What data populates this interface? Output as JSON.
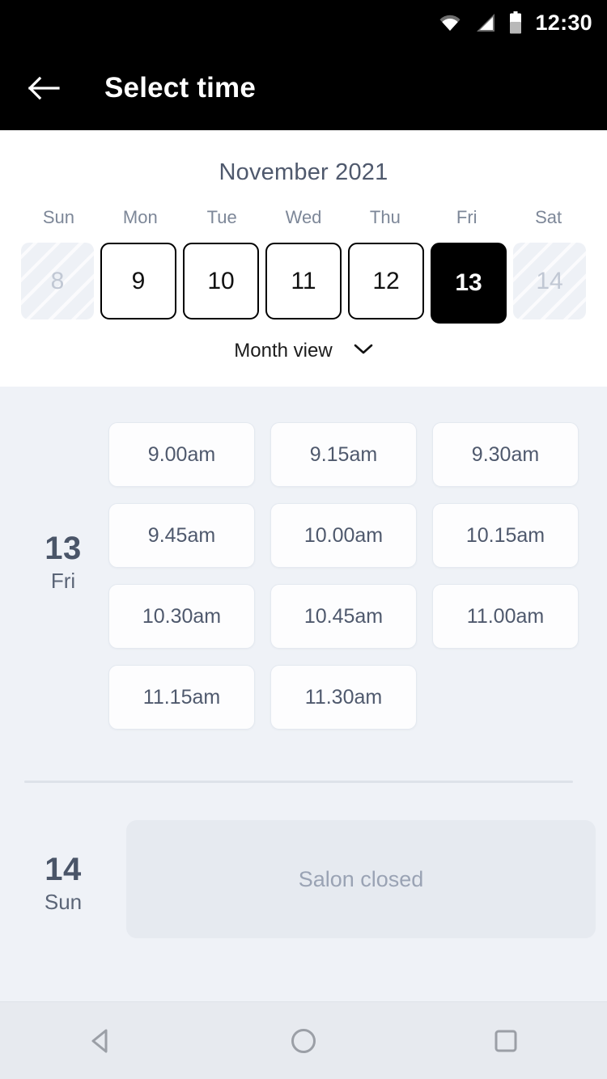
{
  "statusbar": {
    "time": "12:30",
    "icons": [
      "wifi-icon",
      "signal-icon",
      "battery-icon"
    ]
  },
  "appbar": {
    "title": "Select time",
    "back_icon": "arrow-left-icon"
  },
  "calendar": {
    "month_title": "November 2021",
    "weekdays": [
      "Sun",
      "Mon",
      "Tue",
      "Wed",
      "Thu",
      "Fri",
      "Sat"
    ],
    "dates": [
      {
        "num": "8",
        "state": "disabled"
      },
      {
        "num": "9",
        "state": "enabled"
      },
      {
        "num": "10",
        "state": "enabled"
      },
      {
        "num": "11",
        "state": "enabled"
      },
      {
        "num": "12",
        "state": "enabled"
      },
      {
        "num": "13",
        "state": "selected"
      },
      {
        "num": "14",
        "state": "disabled"
      }
    ],
    "view_toggle": {
      "label": "Month view",
      "icon": "chevron-down-icon"
    }
  },
  "schedule": {
    "days": [
      {
        "day_num": "13",
        "day_dow": "Fri",
        "slots": [
          "9.00am",
          "9.15am",
          "9.30am",
          "9.45am",
          "10.00am",
          "10.15am",
          "10.30am",
          "10.45am",
          "11.00am",
          "11.15am",
          "11.30am"
        ]
      },
      {
        "day_num": "14",
        "day_dow": "Sun",
        "closed_label": "Salon closed"
      }
    ]
  },
  "navbar": {
    "back_label": "back-nav",
    "home_label": "home-nav",
    "recents_label": "recents-nav"
  },
  "colors": {
    "accent": "#000000",
    "page_bg": "#eff2f7",
    "panel_bg": "#ffffff",
    "text_primary": "#4f596d",
    "text_muted": "#9aa3b4",
    "closed_bg": "#e6eaf0"
  }
}
